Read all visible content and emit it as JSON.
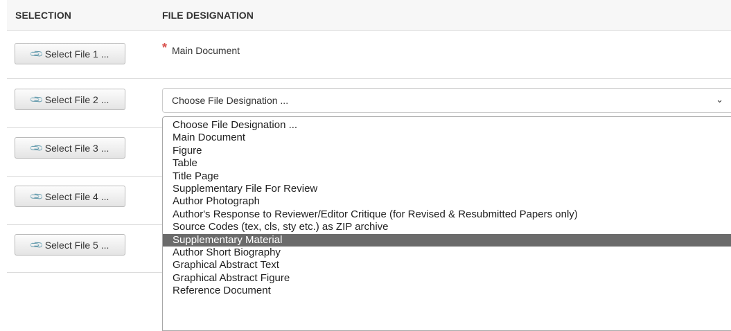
{
  "table": {
    "headers": {
      "selection": "SELECTION",
      "designation": "FILE DESIGNATION"
    }
  },
  "rows": [
    {
      "button": "Select File 1 ..."
    },
    {
      "button": "Select File 2 ..."
    },
    {
      "button": "Select File 3 ..."
    },
    {
      "button": "Select File 4 ..."
    },
    {
      "button": "Select File 5 ..."
    }
  ],
  "row1": {
    "required_marker": "*",
    "designation": "Main Document"
  },
  "row2": {
    "select_value": "Choose File Designation ..."
  },
  "dropdown": {
    "options": [
      "Choose File Designation ...",
      "Main Document",
      "Figure",
      "Table",
      "Title Page",
      "Supplementary File For Review",
      "Author Photograph",
      "Author's Response to Reviewer/Editor Critique (for Revised & Resubmitted Papers only)",
      "Source Codes (tex, cls, sty etc.) as ZIP archive",
      "Supplementary Material",
      "Author Short Biography",
      "Graphical Abstract Text",
      "Graphical Abstract Figure",
      "Reference Document"
    ],
    "highlighted": "Supplementary Material"
  },
  "icons": {
    "file_button": "paperclip-icon",
    "select_arrow": "chevron-down-icon"
  }
}
